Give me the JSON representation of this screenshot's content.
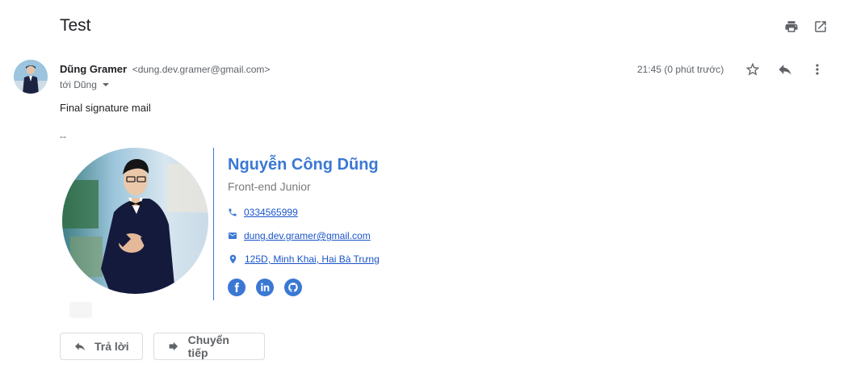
{
  "email": {
    "subject": "Test",
    "sender_name": "Dũng Gramer",
    "sender_email": "<dung.dev.gramer@gmail.com>",
    "recipient_line": "tới Dũng",
    "time": "21:45 (0 phút trước)",
    "body": "Final signature mail",
    "signature_separator": "--"
  },
  "signature": {
    "name": "Nguyễn Công Dũng",
    "title": "Front-end Junior",
    "phone": "0334565999",
    "email": "dung.dev.gramer@gmail.com",
    "address": "125D, Minh Khai, Hai Bà Trưng",
    "socials": [
      "facebook-icon",
      "linkedin-icon",
      "github-icon"
    ]
  },
  "actions": {
    "reply_label": "Trả lời",
    "forward_label": "Chuyển tiếp"
  },
  "colors": {
    "accent": "#3b78d4",
    "link": "#1a55c9",
    "muted": "#5f6368"
  }
}
